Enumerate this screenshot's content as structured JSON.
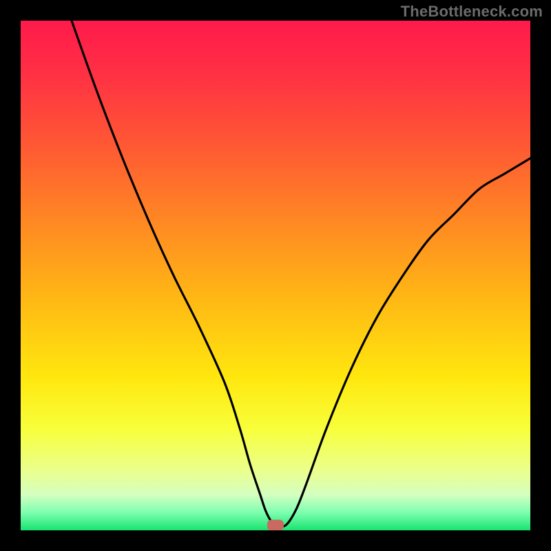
{
  "watermark": "TheBottleneck.com",
  "chart_data": {
    "type": "line",
    "title": "",
    "xlabel": "",
    "ylabel": "",
    "xlim": [
      0,
      100
    ],
    "ylim": [
      0,
      100
    ],
    "curve": {
      "name": "bottleneck-curve",
      "x": [
        10,
        15,
        20,
        25,
        30,
        35,
        40,
        43,
        45,
        47,
        48,
        49,
        50,
        52,
        54,
        56,
        60,
        65,
        70,
        75,
        80,
        85,
        90,
        95,
        100
      ],
      "y": [
        100,
        86,
        73,
        61,
        50,
        40,
        29,
        20,
        13,
        7,
        4,
        2,
        1,
        1,
        4,
        9,
        20,
        32,
        42,
        50,
        57,
        62,
        67,
        70,
        73
      ]
    },
    "marker": {
      "x": 50,
      "y": 1,
      "color": "#c96a62"
    },
    "gradient_stops": [
      {
        "offset": 0.0,
        "color": "#ff1a4b"
      },
      {
        "offset": 0.1,
        "color": "#ff2f44"
      },
      {
        "offset": 0.25,
        "color": "#ff5a33"
      },
      {
        "offset": 0.4,
        "color": "#ff8a22"
      },
      {
        "offset": 0.55,
        "color": "#ffb914"
      },
      {
        "offset": 0.7,
        "color": "#ffe70e"
      },
      {
        "offset": 0.8,
        "color": "#f8ff3a"
      },
      {
        "offset": 0.88,
        "color": "#ecff8a"
      },
      {
        "offset": 0.93,
        "color": "#d4ffc0"
      },
      {
        "offset": 0.965,
        "color": "#7dffb0"
      },
      {
        "offset": 1.0,
        "color": "#19e36f"
      }
    ]
  }
}
